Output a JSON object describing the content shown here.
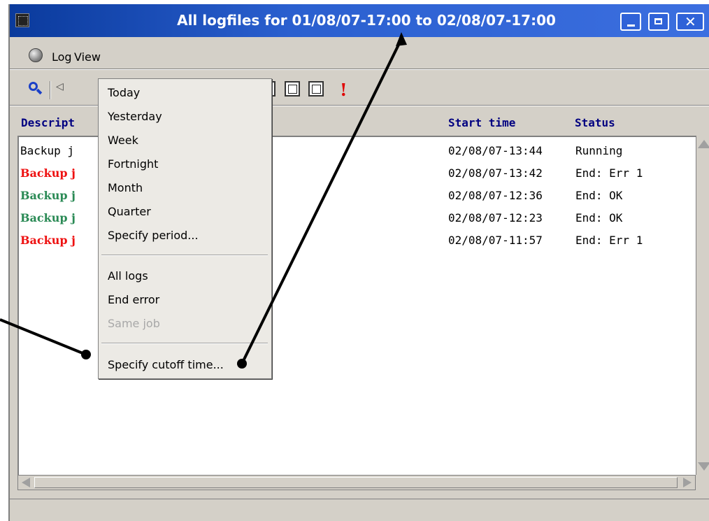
{
  "window": {
    "title": "All logfiles for 01/08/07-17:00 to 02/08/07-17:00",
    "close_glyph": "✕"
  },
  "menubar": {
    "items": [
      {
        "label": "Log"
      },
      {
        "label": "View"
      }
    ]
  },
  "toolbar": {
    "prev_glyph": "◁",
    "alert_glyph": "!"
  },
  "list": {
    "columns": [
      "Descript",
      "Start time",
      "Status"
    ],
    "rows": [
      {
        "desc": "Backup j",
        "start": "02/08/07-13:44",
        "status": "Running",
        "color": "#000000"
      },
      {
        "desc": "Backup j",
        "start": "02/08/07-13:42",
        "status": "End: Err 1",
        "color": "#ee1111"
      },
      {
        "desc": "Backup j",
        "start": "02/08/07-12:36",
        "status": "End: OK",
        "color": "#2a8a55"
      },
      {
        "desc": "Backup j",
        "start": "02/08/07-12:23",
        "status": "End: OK",
        "color": "#2a8a55"
      },
      {
        "desc": "Backup j",
        "start": "02/08/07-11:57",
        "status": "End: Err 1",
        "color": "#ee1111"
      }
    ]
  },
  "view_menu": {
    "items": [
      {
        "label": "Today",
        "enabled": true
      },
      {
        "label": "Yesterday",
        "enabled": true
      },
      {
        "label": "Week",
        "enabled": true
      },
      {
        "label": "Fortnight",
        "enabled": true
      },
      {
        "label": "Month",
        "enabled": true
      },
      {
        "label": "Quarter",
        "enabled": true
      },
      {
        "label": "Specify period...",
        "enabled": true
      },
      {
        "label": "All logs",
        "enabled": true
      },
      {
        "label": "End error",
        "enabled": true
      },
      {
        "label": "Same job",
        "enabled": false
      },
      {
        "label": "Specify cutoff time...",
        "enabled": true
      }
    ]
  },
  "colors": {
    "titlebar": "#2a5fcf",
    "header_text": "#000080",
    "error": "#ee1111",
    "ok": "#2a8a55"
  }
}
